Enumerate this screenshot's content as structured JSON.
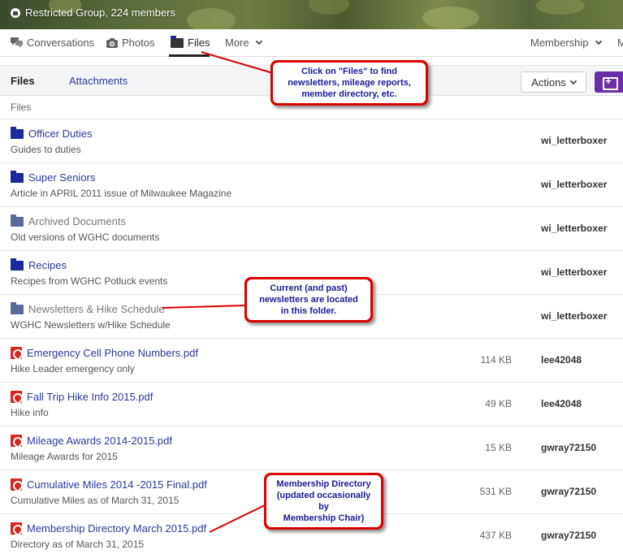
{
  "group": {
    "info": "Restricted Group, 224 members"
  },
  "nav": {
    "conversations": "Conversations",
    "photos": "Photos",
    "files": "Files",
    "more": "More",
    "membership": "Membership",
    "overflow": "M"
  },
  "subbar": {
    "files_tab": "Files",
    "attachments_tab": "Attachments",
    "actions": "Actions"
  },
  "breadcrumb": "Files",
  "rows": [
    {
      "type": "folder",
      "name": "Officer Duties",
      "desc": "Guides to duties",
      "size": "",
      "owner": "wi_letterboxer"
    },
    {
      "type": "folder",
      "name": "Super Seniors",
      "desc": "Article in APRIL 2011 issue of Milwaukee Magazine",
      "size": "",
      "owner": "wi_letterboxer"
    },
    {
      "type": "folder-gray",
      "name": "Archived Documents",
      "desc": "Old versions of WGHC documents",
      "size": "",
      "owner": "wi_letterboxer"
    },
    {
      "type": "folder",
      "name": "Recipes",
      "desc": "Recipes from WGHC Potluck events",
      "size": "",
      "owner": "wi_letterboxer"
    },
    {
      "type": "folder-gray",
      "name": "Newsletters & Hike Schedule",
      "desc": "WGHC Newsletters w/Hike Schedule",
      "size": "",
      "owner": "wi_letterboxer"
    },
    {
      "type": "pdf",
      "name": "Emergency Cell Phone Numbers.pdf",
      "desc": "Hike Leader emergency only",
      "size": "114 KB",
      "owner": "lee42048"
    },
    {
      "type": "pdf",
      "name": "Fall Trip Hike Info 2015.pdf",
      "desc": "Hike info",
      "size": "49 KB",
      "owner": "lee42048"
    },
    {
      "type": "pdf",
      "name": "Mileage Awards 2014-2015.pdf",
      "desc": "Mileage Awards for 2015",
      "size": "15 KB",
      "owner": "gwray72150"
    },
    {
      "type": "pdf",
      "name": "Cumulative Miles 2014 -2015 Final.pdf",
      "desc": "Cumulative Miles as of March 31, 2015",
      "size": "531 KB",
      "owner": "gwray72150"
    },
    {
      "type": "pdf",
      "name": "Membership Directory March 2015.pdf",
      "desc": "Directory as of March 31, 2015",
      "size": "437 KB",
      "owner": "gwray72150"
    }
  ],
  "callouts": {
    "files": [
      "Click on \"Files\" to find",
      "newsletters, mileage reports,",
      "member directory, etc."
    ],
    "newsletters": [
      "Current (and past)",
      "newsletters are located",
      "in this folder."
    ],
    "membership": [
      "Membership Directory",
      "(updated occasionally by",
      "Membership Chair)"
    ]
  },
  "colors": {
    "link": "#2a3a9a",
    "accent": "#6a2fa8",
    "callout_border": "#dd0000",
    "pdf": "#d7261e"
  }
}
